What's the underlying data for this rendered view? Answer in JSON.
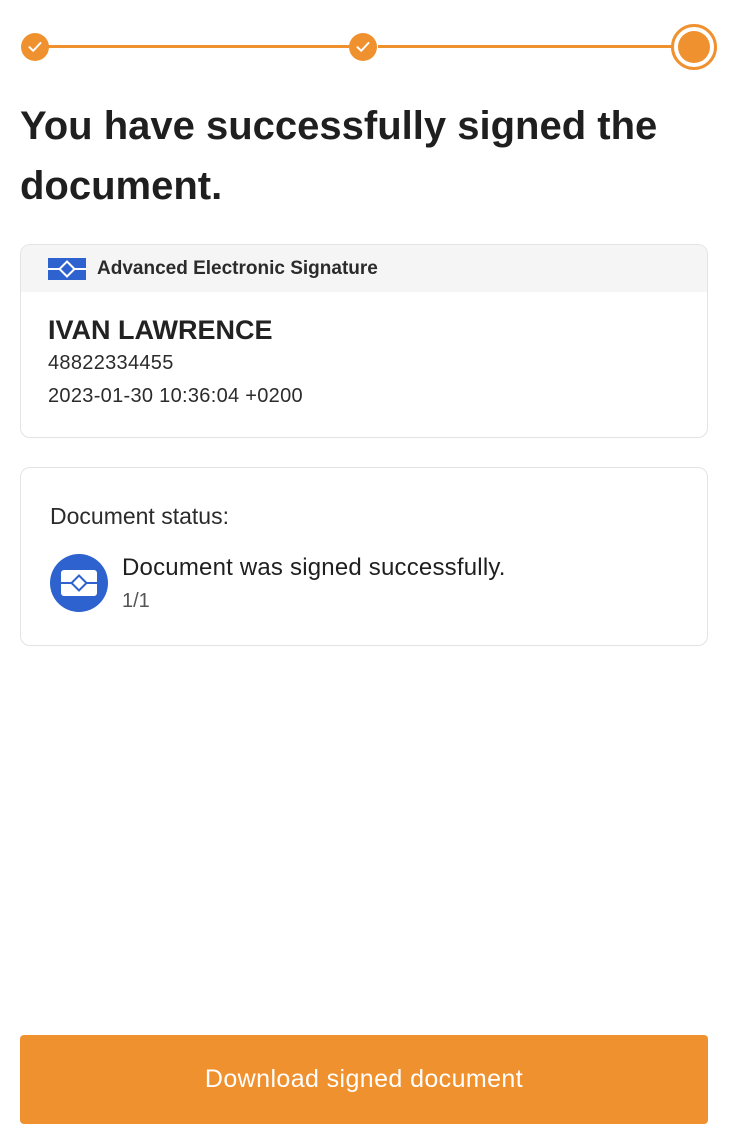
{
  "stepper": {
    "steps_completed": 2,
    "steps_total": 3,
    "current_step": 3,
    "accent_color": "#f0912f"
  },
  "header": {
    "title": "You have successfully signed the document."
  },
  "signature": {
    "type_label": "Advanced Electronic Signature",
    "type_icon": "signature-badge-icon",
    "signer_name": "IVAN LAWRENCE",
    "signer_id": "48822334455",
    "signed_at": "2023-01-30 10:36:04 +0200",
    "badge_color": "#2e63cf"
  },
  "status": {
    "heading": "Document status:",
    "icon": "signature-status-icon",
    "message": "Document was signed successfully.",
    "count": "1/1"
  },
  "actions": {
    "download_label": "Download signed document",
    "button_color": "#f0912f"
  }
}
